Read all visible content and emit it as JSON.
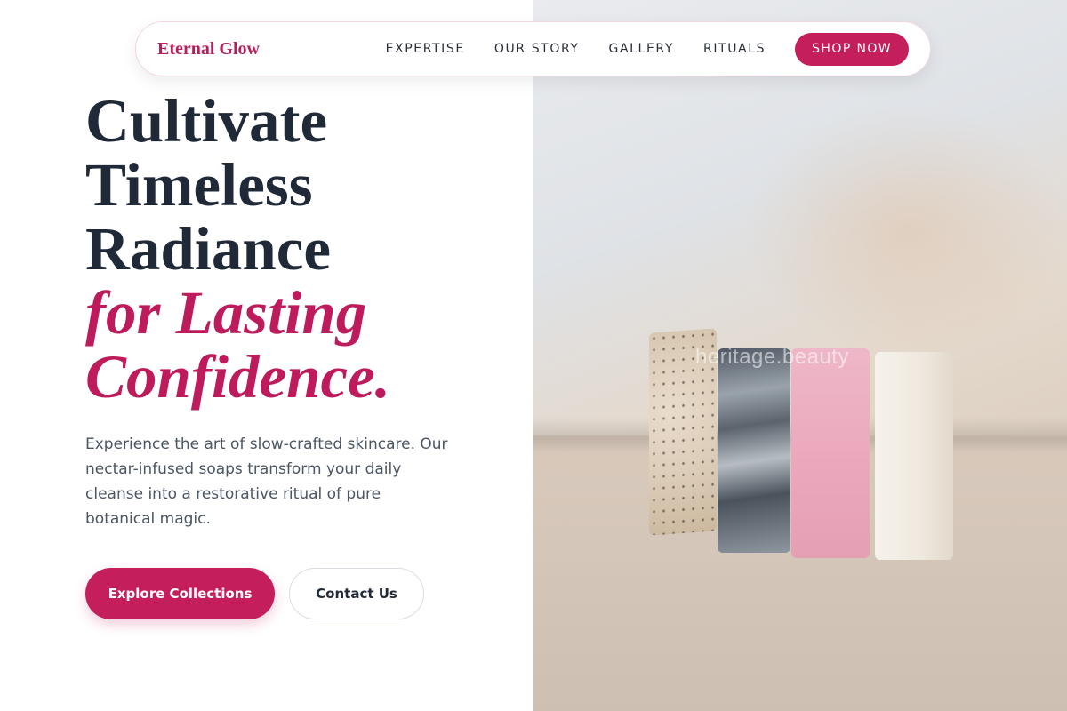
{
  "nav": {
    "brand": "Eternal Glow",
    "links": [
      "EXPERTISE",
      "OUR STORY",
      "GALLERY",
      "RITUALS"
    ],
    "shop_label": "SHOP NOW"
  },
  "hero": {
    "headline_lines": [
      "Cultivate",
      "Timeless",
      "Radiance"
    ],
    "accent_lines": [
      "for Lasting",
      "Confidence."
    ],
    "description": "Experience the art of slow-crafted skincare. Our nectar-infused soaps transform your daily cleanse into a restorative ritual of pure botanical magic.",
    "primary_cta": "Explore Collections",
    "secondary_cta": "Contact Us"
  },
  "photo": {
    "watermark": "heritage.beauty"
  },
  "colors": {
    "accent": "#c41e5d",
    "heading": "#1f2937",
    "body_text": "#4b5563"
  }
}
